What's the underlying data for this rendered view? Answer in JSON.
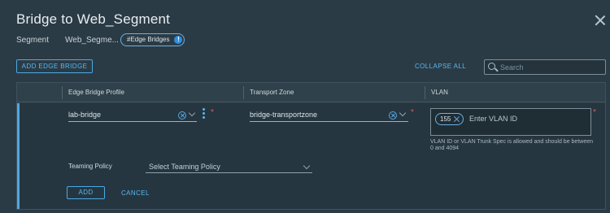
{
  "dialog": {
    "title": "Bridge to Web_Segment",
    "segment_label": "Segment",
    "segment_value": "Web_Segme...",
    "segment_tag": "#Edge Bridges",
    "segment_tag_icon": "info-icon",
    "segment_tag_icon_text": "!"
  },
  "toolbar": {
    "add_label": "ADD EDGE BRIDGE",
    "collapse_label": "COLLAPSE ALL",
    "search_placeholder": "Search"
  },
  "grid": {
    "columns": [
      "Edge Bridge Profile",
      "Transport Zone",
      "VLAN"
    ],
    "row": {
      "edge_bridge_profile": "lab-bridge",
      "transport_zone": "bridge-transportzone",
      "vlan_chips": [
        "155"
      ],
      "vlan_placeholder": "Enter VLAN ID",
      "vlan_help": "VLAN ID or VLAN Trunk Spec is allowed and should be between 0 and 4094",
      "required_marker": "*",
      "teaming_label": "Teaming Policy",
      "teaming_placeholder": "Select Teaming Policy",
      "add_label": "ADD",
      "cancel_label": "CANCEL"
    }
  },
  "colors": {
    "background": "#2b3b45",
    "accent": "#5ab7ee",
    "required": "#e05a5a"
  }
}
